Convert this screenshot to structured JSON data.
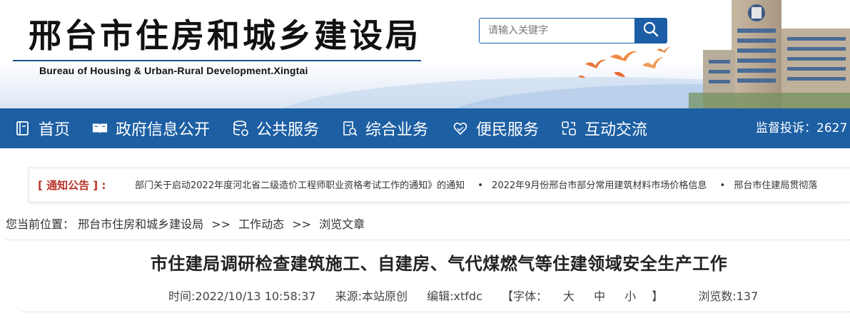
{
  "header": {
    "title_cn": "邢台市住房和城乡建设局",
    "title_en": "Bureau of Housing & Urban-Rural Development.Xingtai",
    "search_placeholder": "请输入关键字"
  },
  "nav": {
    "items": [
      {
        "label": "首页",
        "icon": "book-icon"
      },
      {
        "label": "政府信息公开",
        "icon": "open-book-icon"
      },
      {
        "label": "公共服务",
        "icon": "database-icon"
      },
      {
        "label": "综合业务",
        "icon": "document-search-icon"
      },
      {
        "label": "便民服务",
        "icon": "heart-hand-icon"
      },
      {
        "label": "互动交流",
        "icon": "exchange-icon"
      }
    ],
    "hotline": "监督投诉：2627"
  },
  "notice": {
    "label": "[ 通知公告 ] :",
    "items": [
      "部门关于启动2022年度河北省二级造价工程师职业资格考试工作的通知》的通知",
      "2022年9月份邢台市部分常用建筑材料市场价格信息",
      "邢台市住建局贯彻落"
    ]
  },
  "breadcrumb": {
    "prefix": "您当前位置：",
    "items": [
      "邢台市住房和城乡建设局",
      "工作动态",
      "浏览文章"
    ],
    "separator": ">>"
  },
  "article": {
    "title": "市住建局调研检查建筑施工、自建房、气代煤燃气等住建领域安全生产工作",
    "time": "时间:2022/10/13 10:58:37",
    "source": "来源:本站原创",
    "editor": "编辑:xtfdc",
    "font_size_prefix": "【字体：",
    "font_large": "大",
    "font_medium": "中",
    "font_small": "小",
    "font_size_suffix": "】",
    "views": "浏览数:137"
  },
  "colors": {
    "nav_bg": "#1d5fa3",
    "notice_label": "#b8322a",
    "search_button": "#1b5ea6"
  }
}
